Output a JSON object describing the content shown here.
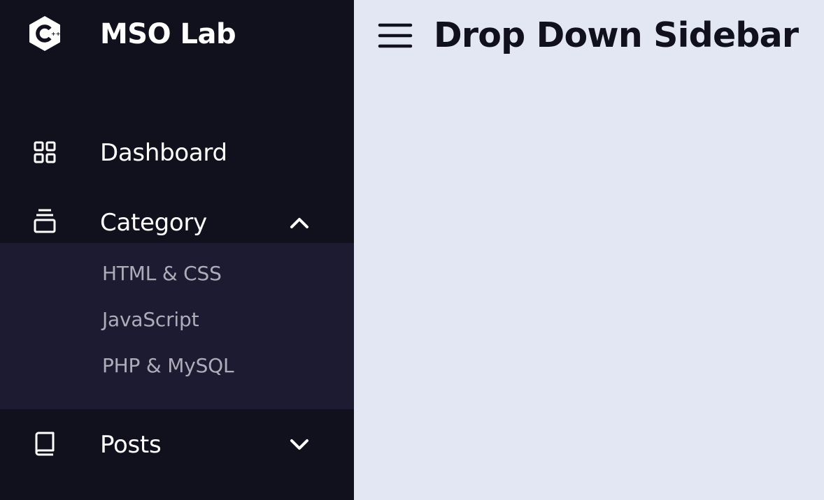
{
  "app": {
    "logo_icon": "cpp-hexagon-logo",
    "name": "MSO Lab"
  },
  "sidebar": {
    "items": [
      {
        "label": "Dashboard",
        "icon": "grid-icon"
      },
      {
        "label": "Category",
        "icon": "collection-icon",
        "expanded": true,
        "submenu": [
          "HTML & CSS",
          "JavaScript",
          "PHP & MySQL"
        ]
      },
      {
        "label": "Posts",
        "icon": "book-icon",
        "expanded": false
      }
    ]
  },
  "header": {
    "menu_icon": "hamburger-menu-icon",
    "title": "Drop Down Sidebar"
  },
  "colors": {
    "sidebar_bg": "#11101d",
    "submenu_bg": "#1d1b31",
    "main_bg": "#e3e7f4",
    "submenu_text": "#aeacb8",
    "title_text": "#11101d"
  }
}
